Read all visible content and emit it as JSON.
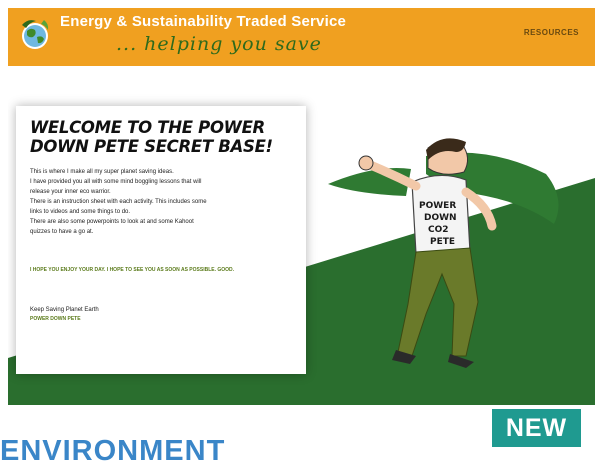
{
  "header": {
    "brand_title": "Energy & Sustainability Traded Service",
    "tagline": "... helping you save",
    "nav_link": "RESOURCES"
  },
  "panel": {
    "title": "WELCOME TO THE POWER DOWN PETE SECRET BASE!",
    "lines": [
      "This is where I make all my super planet saving ideas.",
      "I have provided you all with some mind boggling lessons that will",
      "release your inner eco warrior.",
      "There is an instruction sheet with each activity. This includes some",
      "links to videos and some things to do.",
      "There are also some powerpoints to look at and some Kahoot",
      "quizzes to have a go at."
    ],
    "note": "I HOPE YOU ENJOY YOUR DAY. I HOPE TO SEE YOU AS SOON AS POSSIBLE. GOOD.",
    "signoff": "Keep Saving Planet Earth",
    "signature": "POWER DOWN PETE"
  },
  "hero": {
    "shirt_text": [
      "POWER",
      "DOWN",
      "CO2",
      "PETE"
    ]
  },
  "badge": {
    "label": "NEW"
  },
  "section": {
    "heading": "ENVIRONMENT"
  },
  "colors": {
    "header_orange": "#f0a020",
    "tagline_green": "#2e6a1c",
    "hero_green": "#2a6e2e",
    "badge_teal": "#1f9a90",
    "heading_blue": "#3a86c8"
  }
}
